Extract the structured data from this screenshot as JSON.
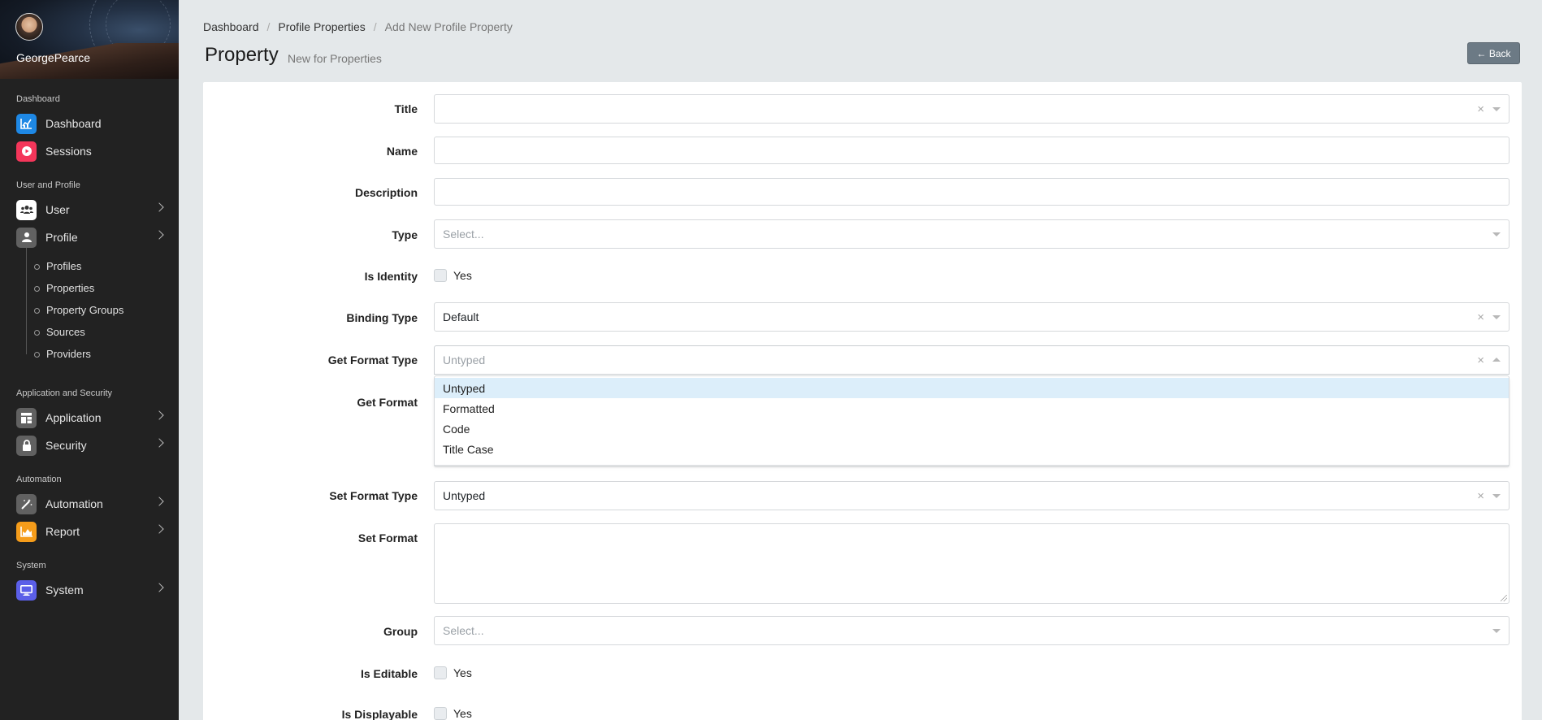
{
  "user": {
    "name": "GeorgePearce"
  },
  "sidebar": {
    "sections": [
      {
        "title": "Dashboard"
      },
      {
        "title": "User and Profile"
      },
      {
        "title": "Application and Security"
      },
      {
        "title": "Automation"
      },
      {
        "title": "System"
      }
    ],
    "items": [
      {
        "label": "Dashboard",
        "icon": "dashboard-chart-icon",
        "color": "#1e88e5"
      },
      {
        "label": "Sessions",
        "icon": "record-icon",
        "color": "#f4365a"
      },
      {
        "label": "User",
        "icon": "users-icon",
        "color": "#ffffff"
      },
      {
        "label": "Profile",
        "icon": "profile-icon",
        "color": "#616161"
      },
      {
        "label": "Application",
        "icon": "application-icon",
        "color": "#616161"
      },
      {
        "label": "Security",
        "icon": "lock-icon",
        "color": "#616161"
      },
      {
        "label": "Automation",
        "icon": "wand-icon",
        "color": "#616161"
      },
      {
        "label": "Report",
        "icon": "report-chart-icon",
        "color": "#f59c1a"
      },
      {
        "label": "System",
        "icon": "monitor-icon",
        "color": "#5b5fe8"
      }
    ],
    "profile_sub": [
      "Profiles",
      "Properties",
      "Property Groups",
      "Sources",
      "Providers"
    ]
  },
  "breadcrumb": [
    "Dashboard",
    "Profile Properties",
    "Add New Profile Property"
  ],
  "page": {
    "title": "Property",
    "subtitle": "New for Properties",
    "back_label": "← Back"
  },
  "form": {
    "title_label": "Title",
    "name_label": "Name",
    "description_label": "Description",
    "type_label": "Type",
    "type_placeholder": "Select...",
    "is_identity_label": "Is Identity",
    "binding_type_label": "Binding Type",
    "binding_type_value": "Default",
    "get_format_type_label": "Get Format Type",
    "get_format_type_placeholder": "Untyped",
    "get_format_label": "Get Format",
    "set_format_type_label": "Set Format Type",
    "set_format_type_value": "Untyped",
    "set_format_label": "Set Format",
    "group_label": "Group",
    "group_placeholder": "Select...",
    "is_editable_label": "Is Editable",
    "is_displayable_label": "Is Displayable",
    "yes_label": "Yes",
    "clear_symbol": "×"
  },
  "dropdown": {
    "options": [
      "Untyped",
      "Formatted",
      "Code",
      "Title Case"
    ],
    "active_index": 0
  },
  "colors": {
    "accent": "#dceefa",
    "back_button": "#6c7a85",
    "sidebar_bg": "#222222",
    "page_bg": "#e4e8ea"
  }
}
